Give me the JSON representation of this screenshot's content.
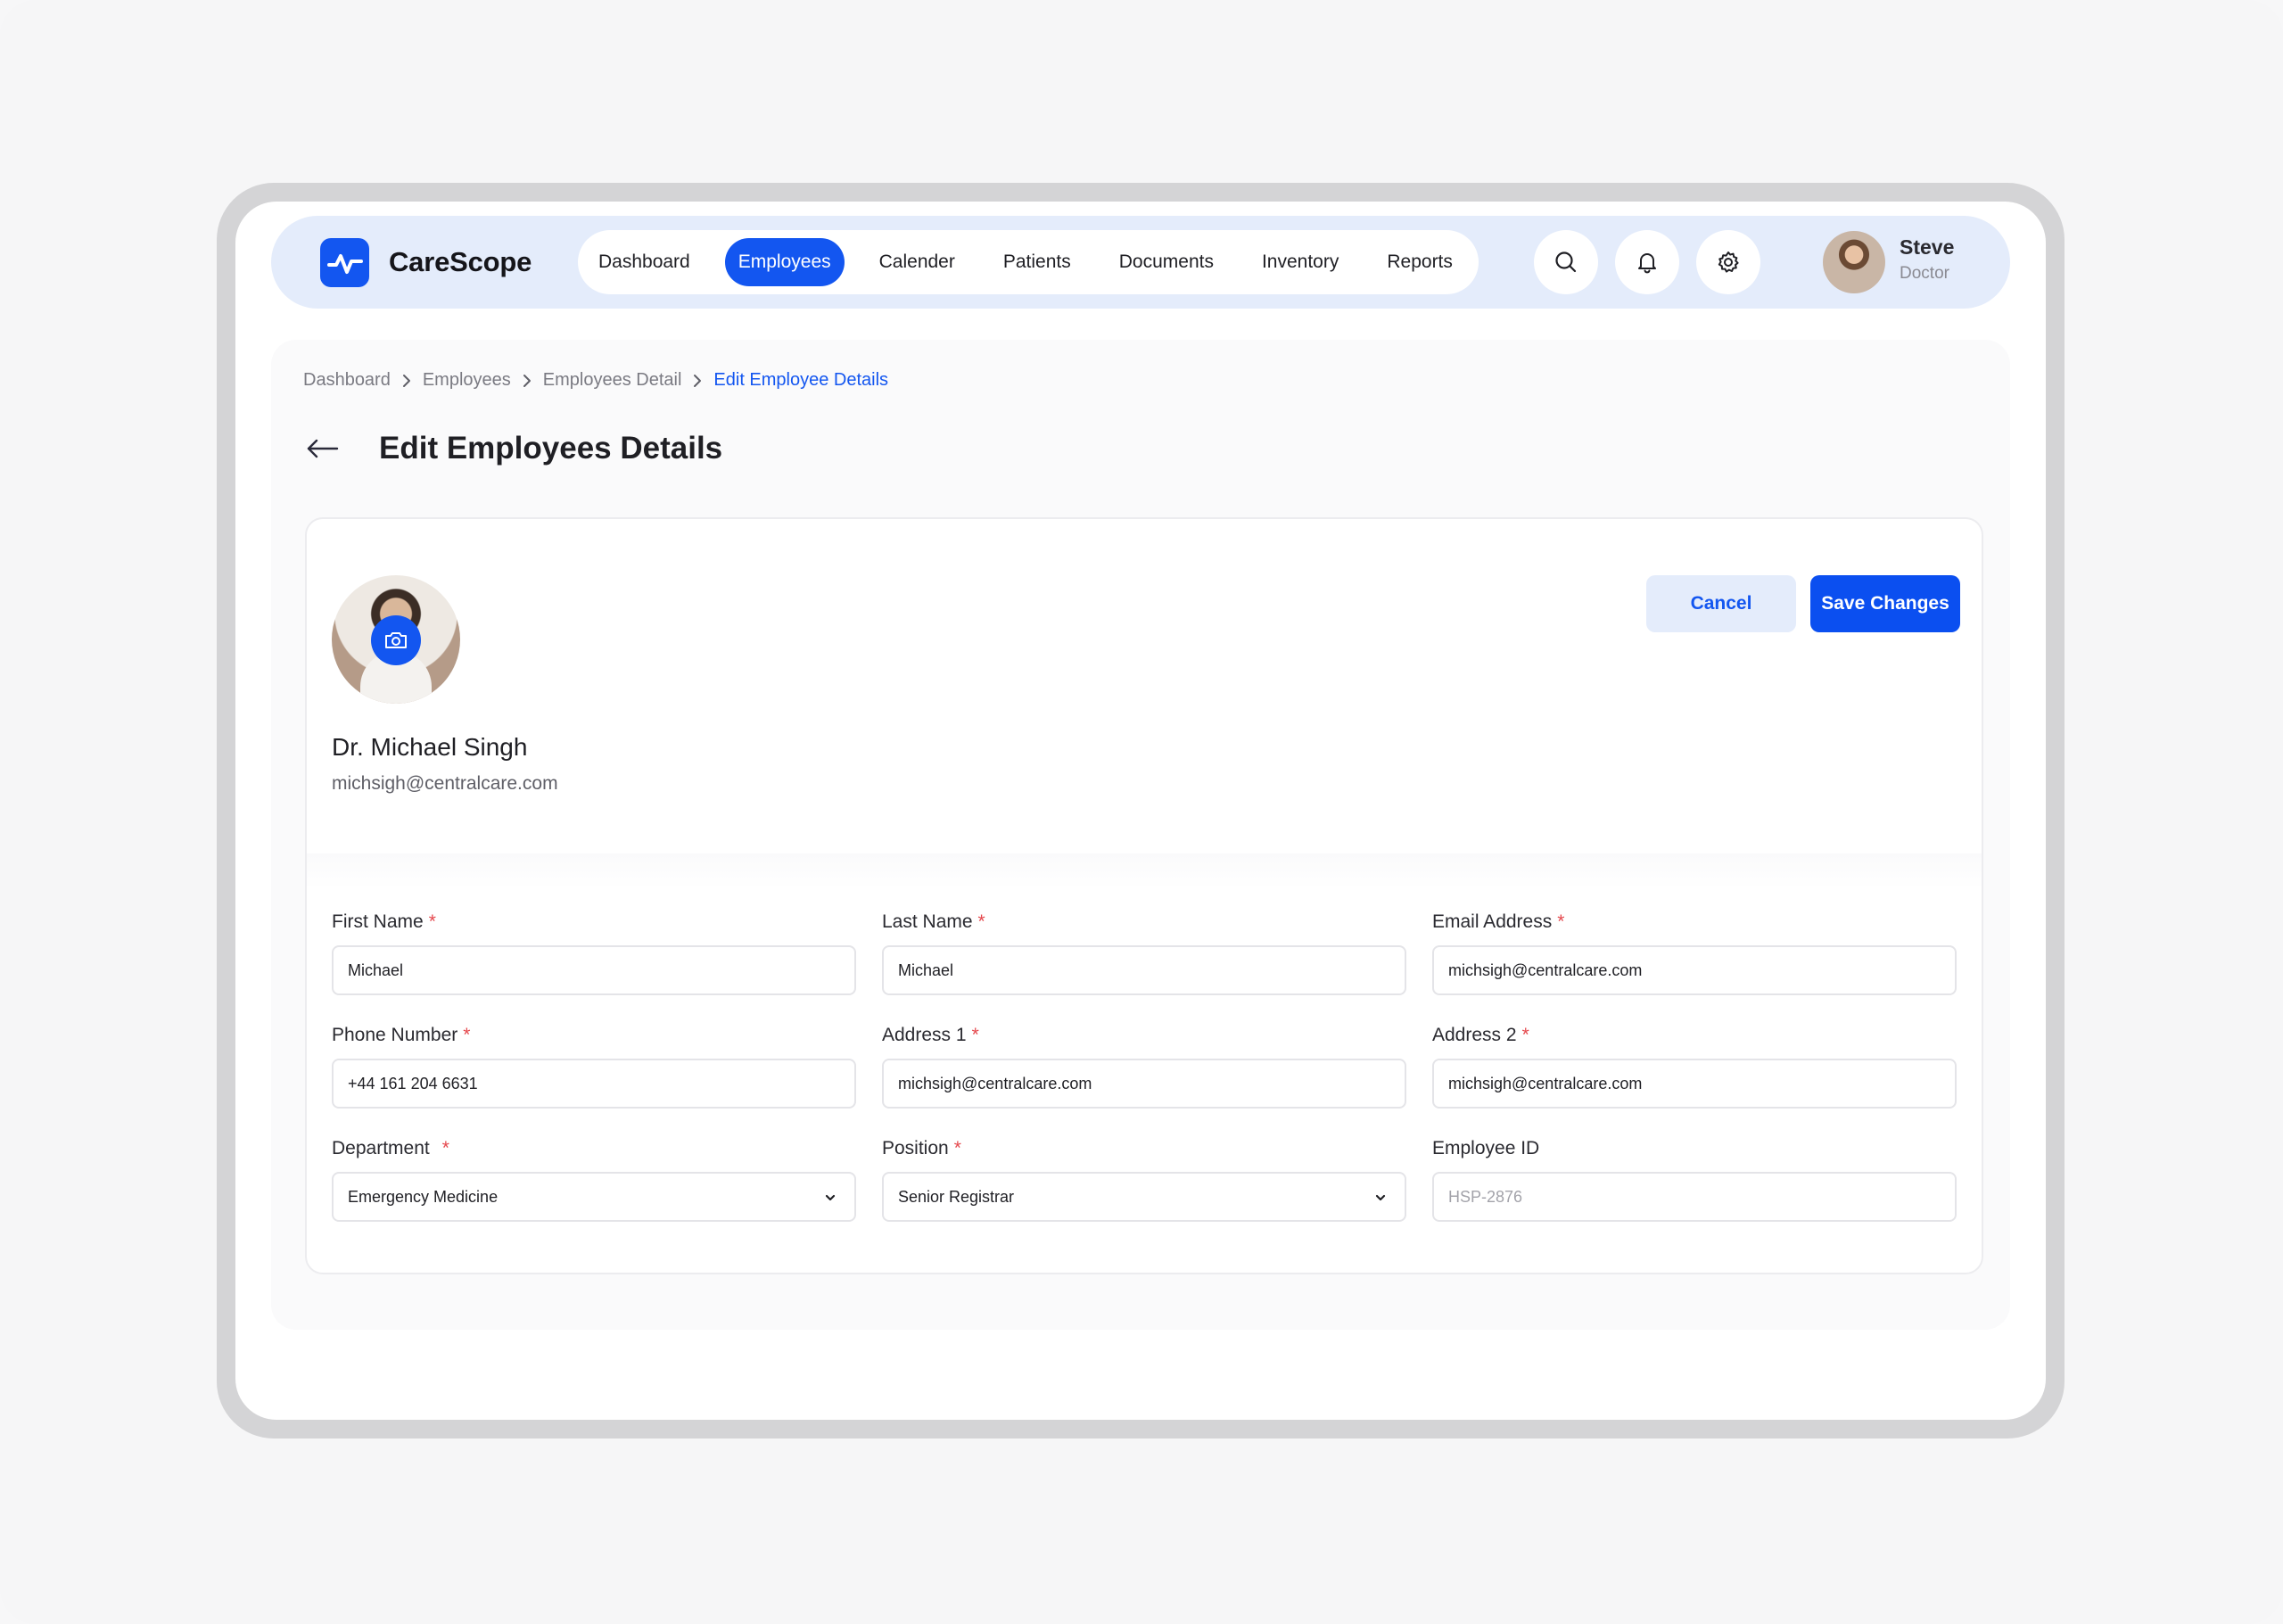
{
  "app": {
    "name": "CareScope"
  },
  "nav": {
    "items": [
      {
        "label": "Dashboard",
        "active": false
      },
      {
        "label": "Employees",
        "active": true
      },
      {
        "label": "Calender",
        "active": false
      },
      {
        "label": "Patients",
        "active": false
      },
      {
        "label": "Documents",
        "active": false
      },
      {
        "label": "Inventory",
        "active": false
      },
      {
        "label": "Reports",
        "active": false
      }
    ]
  },
  "header_icons": [
    "search-icon",
    "bell-icon",
    "gear-icon"
  ],
  "user": {
    "name": "Steve",
    "role": "Doctor"
  },
  "breadcrumb": [
    "Dashboard",
    "Employees",
    "Employees Detail",
    "Edit Employee Details"
  ],
  "page": {
    "title": "Edit Employees Details"
  },
  "profile": {
    "name": "Dr. Michael Singh",
    "email": "michsigh@centralcare.com"
  },
  "actions": {
    "cancel": "Cancel",
    "save": "Save Changes"
  },
  "form": {
    "first_name": {
      "label": "First Name",
      "required": "*",
      "value": "Michael"
    },
    "last_name": {
      "label": "Last Name",
      "required": "*",
      "value": "Michael"
    },
    "email": {
      "label": "Email Address",
      "required": "*",
      "value": "michsigh@centralcare.com"
    },
    "phone": {
      "label": "Phone Number",
      "required": "*",
      "value": "+44 161 204 6631"
    },
    "address1": {
      "label": "Address 1",
      "required": "*",
      "value": "michsigh@centralcare.com"
    },
    "address2": {
      "label": "Address 2",
      "required": "*",
      "value": "michsigh@centralcare.com"
    },
    "department": {
      "label": "Department",
      "required": "*",
      "value": "Emergency Medicine"
    },
    "position": {
      "label": "Position",
      "required": "*",
      "value": "Senior Registrar"
    },
    "employee_id": {
      "label": "Employee ID",
      "value": "HSP-2876"
    }
  },
  "colors": {
    "accent": "#1356f0",
    "accent_soft": "#e4ecfb",
    "required": "#e5484d"
  }
}
